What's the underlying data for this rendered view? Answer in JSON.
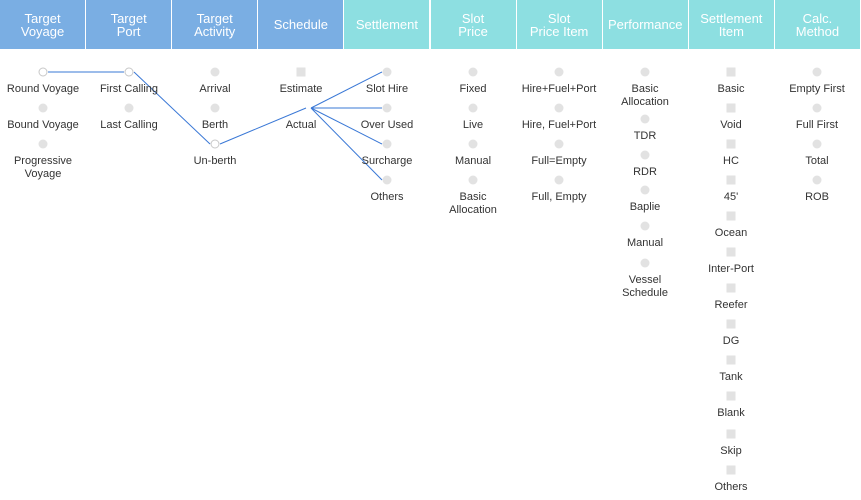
{
  "columns": [
    {
      "id": "target_voyage",
      "header": "Target\nVoyage",
      "tone": "blue",
      "items": [
        {
          "label": "Round Voyage",
          "marker": "ring"
        },
        {
          "label": "Bound Voyage",
          "marker": "dot"
        },
        {
          "label": "Progressive\nVoyage",
          "marker": "dot"
        }
      ]
    },
    {
      "id": "target_port",
      "header": "Target\nPort",
      "tone": "blue",
      "items": [
        {
          "label": "First Calling",
          "marker": "ring"
        },
        {
          "label": "Last Calling",
          "marker": "dot"
        }
      ]
    },
    {
      "id": "target_activity",
      "header": "Target\nActivity",
      "tone": "blue",
      "items": [
        {
          "label": "Arrival",
          "marker": "dot"
        },
        {
          "label": "Berth",
          "marker": "dot"
        },
        {
          "label": "Un-berth",
          "marker": "ring"
        }
      ]
    },
    {
      "id": "schedule",
      "header": "Schedule",
      "tone": "blue",
      "items": [
        {
          "label": "Estimate",
          "marker": "square"
        },
        {
          "label": "Actual",
          "marker": "none"
        }
      ]
    },
    {
      "id": "settlement",
      "header": "Settlement",
      "tone": "teal",
      "items": [
        {
          "label": "Slot Hire",
          "marker": "dot"
        },
        {
          "label": "Over Used",
          "marker": "dot"
        },
        {
          "label": "Surcharge",
          "marker": "dot"
        },
        {
          "label": "Others",
          "marker": "dot"
        }
      ]
    },
    {
      "id": "slot_price",
      "header": "Slot\nPrice",
      "tone": "teal",
      "items": [
        {
          "label": "Fixed",
          "marker": "dot"
        },
        {
          "label": "Live",
          "marker": "dot"
        },
        {
          "label": "Manual",
          "marker": "dot"
        },
        {
          "label": "Basic\nAllocation",
          "marker": "dot"
        }
      ]
    },
    {
      "id": "slot_price_item",
      "header": "Slot\nPrice Item",
      "tone": "teal",
      "items": [
        {
          "label": "Hire+Fuel+Port",
          "marker": "dot"
        },
        {
          "label": "Hire, Fuel+Port",
          "marker": "dot"
        },
        {
          "label": "Full=Empty",
          "marker": "dot"
        },
        {
          "label": "Full, Empty",
          "marker": "dot"
        }
      ]
    },
    {
      "id": "performance",
      "header": "Performance",
      "tone": "teal",
      "items": [
        {
          "label": "Basic\nAllocation",
          "marker": "dot"
        },
        {
          "label": "TDR",
          "marker": "dot"
        },
        {
          "label": "RDR",
          "marker": "dot"
        },
        {
          "label": "Baplie",
          "marker": "dot"
        },
        {
          "label": "Manual",
          "marker": "dot"
        },
        {
          "label": "Vessel\nSchedule",
          "marker": "dot"
        }
      ]
    },
    {
      "id": "settlement_item",
      "header": "Settlement\nItem",
      "tone": "teal",
      "items": [
        {
          "label": "Basic",
          "marker": "square"
        },
        {
          "label": "Void",
          "marker": "square"
        },
        {
          "label": "HC",
          "marker": "square"
        },
        {
          "label": "45'",
          "marker": "square"
        },
        {
          "label": "Ocean",
          "marker": "square"
        },
        {
          "label": "Inter-Port",
          "marker": "square"
        },
        {
          "label": "Reefer",
          "marker": "square"
        },
        {
          "label": "DG",
          "marker": "square"
        },
        {
          "label": "Tank",
          "marker": "square"
        },
        {
          "label": "Blank",
          "marker": "square"
        },
        {
          "label": "Skip",
          "marker": "square"
        },
        {
          "label": "Others",
          "marker": "square"
        }
      ]
    },
    {
      "id": "calc_method",
      "header": "Calc.\nMethod",
      "tone": "teal",
      "items": [
        {
          "label": "Empty First",
          "marker": "dot"
        },
        {
          "label": "Full First",
          "marker": "dot"
        },
        {
          "label": "Total",
          "marker": "dot"
        },
        {
          "label": "ROB",
          "marker": "dot"
        }
      ]
    }
  ],
  "connections": [
    {
      "from": "target_voyage.0",
      "to": "target_port.0"
    },
    {
      "from": "target_port.0",
      "to": "target_activity.2"
    },
    {
      "from": "target_activity.2",
      "to": "schedule.1"
    },
    {
      "from": "schedule.1",
      "to": "settlement.0"
    },
    {
      "from": "schedule.1",
      "to": "settlement.1"
    },
    {
      "from": "schedule.1",
      "to": "settlement.2"
    },
    {
      "from": "schedule.1",
      "to": "settlement.3"
    }
  ],
  "colors": {
    "line": "#3a78d6",
    "header_blue": "#7aaee3",
    "header_teal": "#8ddfe1"
  }
}
